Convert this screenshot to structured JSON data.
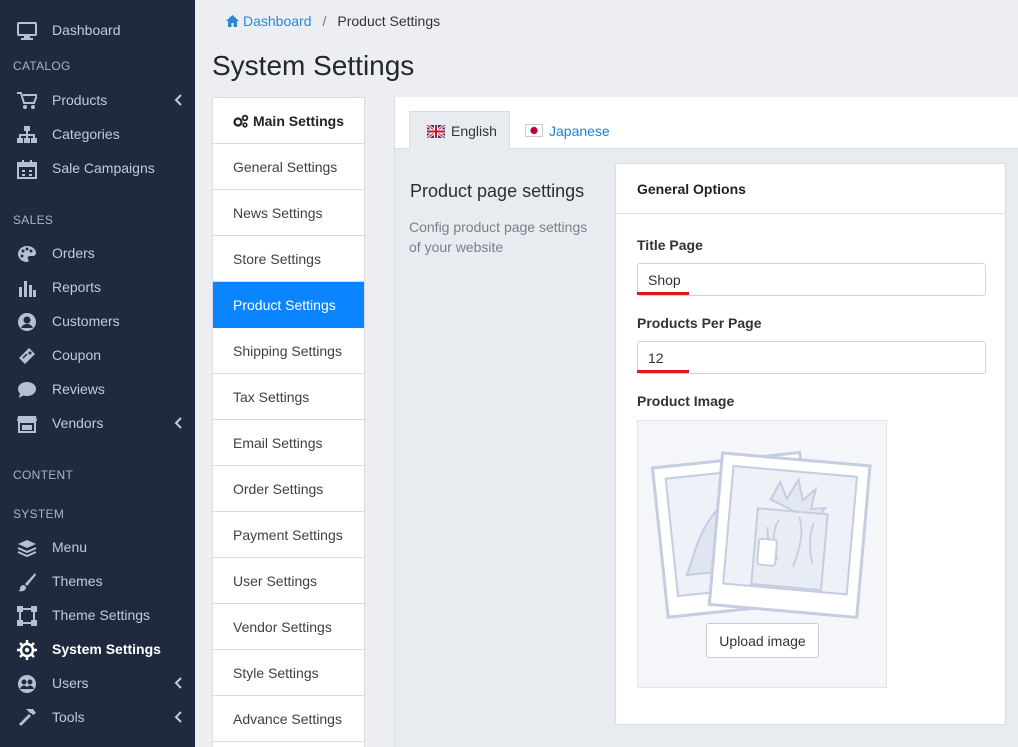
{
  "sidebar": {
    "dashboard": "Dashboard",
    "sections": {
      "catalog": "CATALOG",
      "sales": "SALES",
      "content": "CONTENT",
      "system": "SYSTEM"
    },
    "items": {
      "products": "Products",
      "categories": "Categories",
      "sale_campaigns": "Sale Campaigns",
      "orders": "Orders",
      "reports": "Reports",
      "customers": "Customers",
      "coupon": "Coupon",
      "reviews": "Reviews",
      "vendors": "Vendors",
      "menu": "Menu",
      "themes": "Themes",
      "theme_settings": "Theme Settings",
      "system_settings": "System Settings",
      "users": "Users",
      "tools": "Tools"
    },
    "active": "System Settings"
  },
  "breadcrumb": {
    "home": "Dashboard",
    "current": "Product Settings"
  },
  "page_title": "System Settings",
  "settings_menu": {
    "header": "Main Settings",
    "items": [
      "General Settings",
      "News Settings",
      "Store Settings",
      "Product Settings",
      "Shipping Settings",
      "Tax Settings",
      "Email Settings",
      "Order Settings",
      "Payment Settings",
      "User Settings",
      "Vendor Settings",
      "Style Settings",
      "Advance Settings"
    ],
    "active": "Product Settings"
  },
  "tabs": {
    "english": "English",
    "japanese": "Japanese"
  },
  "section": {
    "title": "Product page settings",
    "description": "Config product page settings of your website"
  },
  "card": {
    "title": "General Options",
    "title_page_label": "Title Page",
    "title_page_value": "Shop",
    "products_per_page_label": "Products Per Page",
    "products_per_page_value": "12",
    "product_image_label": "Product Image",
    "upload_button": "Upload image"
  },
  "colors": {
    "sidebar_bg": "#1f2a40",
    "accent": "#0a84ff",
    "link": "#2f86d6",
    "error_underline": "#e0161b"
  }
}
